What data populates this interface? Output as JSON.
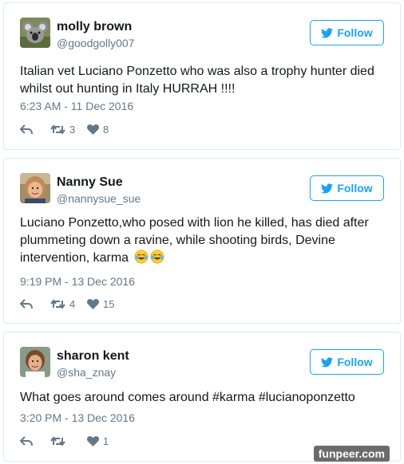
{
  "tweets": [
    {
      "name": "molly brown",
      "handle": "@goodgolly007",
      "follow_label": "Follow",
      "text": "Italian vet Luciano Ponzetto who was also a trophy hunter died whilst out hunting in Italy HURRAH !!!!",
      "time": "6:23 AM - 11 Dec 2016",
      "retweets": "3",
      "likes": "8",
      "avatar": "koala-avatar"
    },
    {
      "name": "Nanny Sue",
      "handle": "@nannysue_sue",
      "follow_label": "Follow",
      "text": "Luciano Ponzetto,who posed with lion he killed, has died after plummeting down a ravine, while shooting birds, Devine intervention, karma",
      "emojis": [
        "tears-of-joy-emoji",
        "tears-of-joy-emoji"
      ],
      "time": "9:19 PM - 13 Dec 2016",
      "retweets": "4",
      "likes": "15",
      "avatar": "woman-avatar"
    },
    {
      "name": "sharon kent",
      "handle": "@sha_znay",
      "follow_label": "Follow",
      "text": "What goes around comes around #karma #lucianoponzetto",
      "time": "3:20 PM - 13 Dec 2016",
      "retweets": "",
      "likes": "1",
      "avatar": "woman-avatar"
    }
  ],
  "watermark": "funpeer.com",
  "colors": {
    "brand_blue": "#1da1f2",
    "text": "#14171a",
    "muted": "#657786",
    "border": "#e1e8ed"
  }
}
